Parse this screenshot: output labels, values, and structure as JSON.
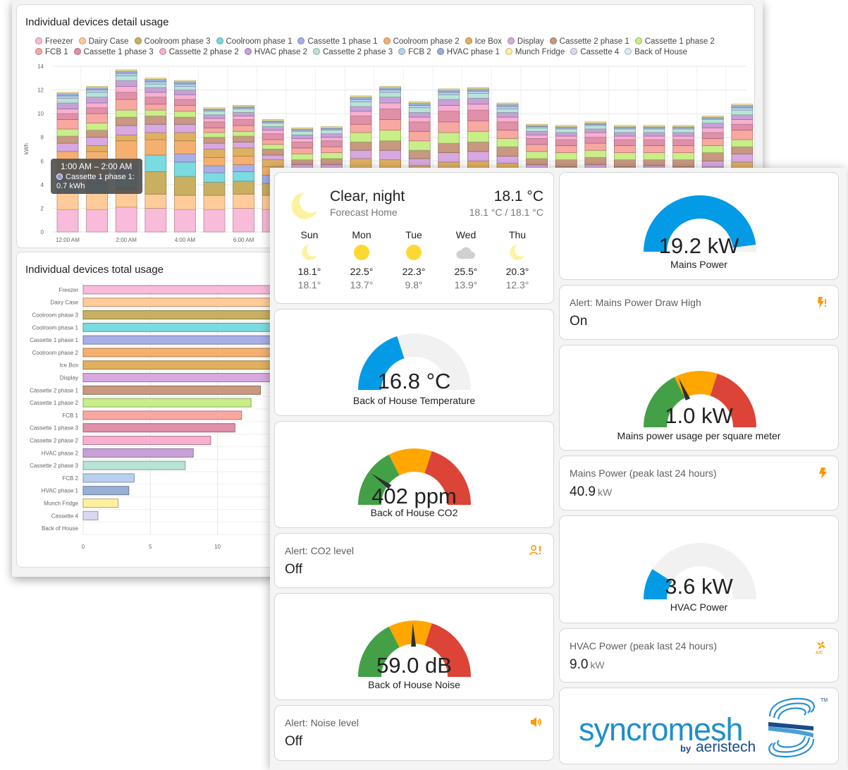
{
  "detail_card": {
    "title": "Individual devices detail usage",
    "tooltip": {
      "time": "1:00 AM – 2:00 AM",
      "series": "Cassette 1 phase 1:",
      "value": "0.7 kWh"
    }
  },
  "total_card": {
    "title": "Individual devices total usage"
  },
  "colors": {
    "Freezer": "#f8bbd9",
    "Dairy Case": "#ffcc99",
    "Coolroom phase 3": "#c8b060",
    "Coolroom phase 1": "#7adbe0",
    "Cassette 1 phase 1": "#a8aee8",
    "Coolroom phase 2": "#f5b070",
    "Ice Box": "#e0b060",
    "Display": "#d8a8e0",
    "Cassette 2 phase 1": "#c89880",
    "Cassette 1 phase 2": "#c8ee88",
    "FCB 1": "#f8a8a0",
    "Cassette 1 phase 3": "#e090a8",
    "Cassette 2 phase 2": "#f8b0d0",
    "HVAC phase 2": "#c8a0d8",
    "Cassette 2 phase 3": "#b8e4d8",
    "FCB 2": "#b8d0f0",
    "HVAC phase 1": "#98b0d8",
    "Munch Fridge": "#fff0a0",
    "Cassette 4": "#d8d8f0",
    "Back of House": "#d8ecf8"
  },
  "chart_data": [
    {
      "type": "bar",
      "title": "Individual devices detail usage",
      "stacked": true,
      "ylabel": "kWh",
      "ylim": [
        0,
        14
      ],
      "yticks": [
        "0",
        "2",
        "4",
        "6",
        "8",
        "10",
        "12",
        "14"
      ],
      "xticks": [
        "12:00 AM",
        "2:00 AM",
        "4:00 AM",
        "6:00 AM"
      ],
      "categories": [
        "0",
        "1",
        "2",
        "3",
        "4",
        "5",
        "6",
        "7",
        "8",
        "9",
        "10",
        "11",
        "12",
        "13",
        "14",
        "15",
        "16",
        "17",
        "18",
        "19",
        "20",
        "21",
        "22",
        "23"
      ],
      "series": [
        {
          "name": "Freezer",
          "values": [
            1.9,
            1.9,
            2.1,
            2.0,
            1.9,
            1.9,
            2.0,
            1.9,
            1.9,
            1.9,
            2.0,
            2.0,
            2.0,
            2.0,
            2.0,
            1.9,
            1.9,
            1.9,
            1.9,
            1.9,
            1.9,
            1.9,
            1.9,
            1.9
          ]
        },
        {
          "name": "Dairy Case",
          "values": [
            1.4,
            1.4,
            1.5,
            1.2,
            1.2,
            1.2,
            1.2,
            1.2,
            1.1,
            1.1,
            1.3,
            1.3,
            1.2,
            1.3,
            1.3,
            1.2,
            1.1,
            1.1,
            1.1,
            1.1,
            1.1,
            1.1,
            1.1,
            1.2
          ]
        },
        {
          "name": "Coolroom phase 3",
          "values": [
            0.0,
            0.0,
            0.1,
            1.9,
            1.6,
            1.1,
            1.1,
            1.0,
            0.0,
            0.0,
            0.1,
            0.0,
            0.0,
            0.0,
            0.0,
            0.0,
            0.0,
            0.0,
            0.0,
            0.0,
            0.0,
            0.0,
            0.0,
            0.0
          ]
        },
        {
          "name": "Coolroom phase 1",
          "values": [
            0.8,
            0.8,
            1.2,
            1.4,
            1.2,
            0.8,
            0.8,
            0.0,
            0.0,
            0.0,
            0.2,
            0.2,
            0.2,
            0.2,
            0.2,
            0.1,
            0.0,
            0.0,
            0.0,
            0.0,
            0.0,
            0.0,
            0.2,
            0.3
          ]
        },
        {
          "name": "Cassette 1 phase 1",
          "values": [
            0.7,
            0.7,
            0.8,
            0.0,
            0.7,
            0.6,
            0.6,
            0.7,
            0.7,
            0.7,
            0.9,
            1.0,
            0.9,
            1.0,
            1.0,
            1.2,
            0.8,
            0.7,
            0.8,
            0.7,
            0.7,
            0.7,
            0.8,
            0.9
          ]
        },
        {
          "name": "Coolroom phase 2",
          "values": [
            2.0,
            2.0,
            2.0,
            1.3,
            1.1,
            0.7,
            0.7,
            0.7,
            0.6,
            0.6,
            0.7,
            0.6,
            0.5,
            0.6,
            0.6,
            0.6,
            0.6,
            0.6,
            0.6,
            0.6,
            0.6,
            0.6,
            0.7,
            0.8
          ]
        },
        {
          "name": "Ice Box",
          "values": [
            0.0,
            0.5,
            0.5,
            0.6,
            0.7,
            0.7,
            0.7,
            0.6,
            0.9,
            0.9,
            1.0,
            1.0,
            0.8,
            0.8,
            0.9,
            0.8,
            0.8,
            0.7,
            0.8,
            0.7,
            0.8,
            0.7,
            0.8,
            0.8
          ]
        },
        {
          "name": "Display",
          "values": [
            0.7,
            0.7,
            0.8,
            0.7,
            0.7,
            0.5,
            0.5,
            0.4,
            0.5,
            0.5,
            0.7,
            0.8,
            0.6,
            0.8,
            0.8,
            0.6,
            0.5,
            0.5,
            0.5,
            0.5,
            0.5,
            0.5,
            0.5,
            0.7
          ]
        },
        {
          "name": "Cassette 2 phase 1",
          "values": [
            0.6,
            0.6,
            0.7,
            0.7,
            0.6,
            0.5,
            0.5,
            0.5,
            0.4,
            0.5,
            0.7,
            0.8,
            0.7,
            0.8,
            0.8,
            0.8,
            0.5,
            0.6,
            0.6,
            0.6,
            0.5,
            0.6,
            0.7,
            0.6
          ]
        },
        {
          "name": "Cassette 1 phase 2",
          "values": [
            0.6,
            0.6,
            0.6,
            0.5,
            0.5,
            0.4,
            0.4,
            0.4,
            0.5,
            0.5,
            0.8,
            0.9,
            0.8,
            0.9,
            0.9,
            0.7,
            0.6,
            0.6,
            0.6,
            0.6,
            0.6,
            0.6,
            0.6,
            0.6
          ]
        },
        {
          "name": "FCB 1",
          "values": [
            0.8,
            0.8,
            0.9,
            0.5,
            0.5,
            0.4,
            0.5,
            0.4,
            0.5,
            0.5,
            0.7,
            0.9,
            0.8,
            0.9,
            0.9,
            0.7,
            0.6,
            0.6,
            0.6,
            0.6,
            0.6,
            0.6,
            0.6,
            0.8
          ]
        },
        {
          "name": "Cassette 1 phase 3",
          "values": [
            0.5,
            0.5,
            0.6,
            0.6,
            0.5,
            0.5,
            0.5,
            0.5,
            0.5,
            0.5,
            0.7,
            0.9,
            0.8,
            0.9,
            0.9,
            0.7,
            0.5,
            0.5,
            0.5,
            0.5,
            0.5,
            0.5,
            0.5,
            0.5
          ]
        },
        {
          "name": "Cassette 2 phase 2",
          "values": [
            0.4,
            0.4,
            0.5,
            0.4,
            0.4,
            0.3,
            0.3,
            0.3,
            0.3,
            0.3,
            0.4,
            0.5,
            0.4,
            0.5,
            0.5,
            0.4,
            0.3,
            0.3,
            0.4,
            0.3,
            0.3,
            0.3,
            0.4,
            0.4
          ]
        },
        {
          "name": "HVAC phase 2",
          "values": [
            0.5,
            0.5,
            0.5,
            0.4,
            0.4,
            0.3,
            0.3,
            0.3,
            0.3,
            0.3,
            0.4,
            0.5,
            0.4,
            0.5,
            0.5,
            0.4,
            0.3,
            0.3,
            0.3,
            0.3,
            0.3,
            0.3,
            0.4,
            0.4
          ]
        },
        {
          "name": "Cassette 2 phase 3",
          "values": [
            0.4,
            0.4,
            0.4,
            0.3,
            0.3,
            0.3,
            0.3,
            0.3,
            0.3,
            0.3,
            0.4,
            0.4,
            0.4,
            0.4,
            0.4,
            0.3,
            0.3,
            0.3,
            0.3,
            0.3,
            0.3,
            0.3,
            0.3,
            0.4
          ]
        },
        {
          "name": "FCB 2",
          "values": [
            0.2,
            0.2,
            0.2,
            0.2,
            0.2,
            0.1,
            0.1,
            0.1,
            0.1,
            0.1,
            0.2,
            0.2,
            0.2,
            0.2,
            0.2,
            0.2,
            0.1,
            0.1,
            0.1,
            0.1,
            0.1,
            0.1,
            0.1,
            0.2
          ]
        },
        {
          "name": "HVAC phase 1",
          "values": [
            0.2,
            0.2,
            0.2,
            0.2,
            0.2,
            0.1,
            0.1,
            0.1,
            0.1,
            0.1,
            0.2,
            0.2,
            0.2,
            0.2,
            0.2,
            0.2,
            0.1,
            0.1,
            0.1,
            0.1,
            0.1,
            0.1,
            0.1,
            0.2
          ]
        },
        {
          "name": "Munch Fridge",
          "values": [
            0.1,
            0.1,
            0.1,
            0.1,
            0.1,
            0.1,
            0.1,
            0.1,
            0.1,
            0.1,
            0.1,
            0.1,
            0.1,
            0.1,
            0.1,
            0.1,
            0.1,
            0.1,
            0.1,
            0.1,
            0.1,
            0.1,
            0.1,
            0.1
          ]
        },
        {
          "name": "Cassette 4",
          "values": [
            0.0,
            0.0,
            0.0,
            0.0,
            0.0,
            0.0,
            0.0,
            0.0,
            0.0,
            0.0,
            0.0,
            0.0,
            0.0,
            0.0,
            0.0,
            0.0,
            0.0,
            0.0,
            0.0,
            0.0,
            0.0,
            0.0,
            0.0,
            0.0
          ]
        },
        {
          "name": "Back of House",
          "values": [
            0.0,
            0.0,
            0.0,
            0.0,
            0.0,
            0.0,
            0.0,
            0.0,
            0.0,
            0.0,
            0.0,
            0.0,
            0.0,
            0.0,
            0.0,
            0.0,
            0.0,
            0.0,
            0.0,
            0.0,
            0.0,
            0.0,
            0.0,
            0.0
          ]
        }
      ]
    },
    {
      "type": "bar",
      "orientation": "horizontal",
      "title": "Individual devices total usage",
      "xticks": [
        "0",
        "5",
        "10"
      ],
      "categories": [
        "Freezer",
        "Dairy Case",
        "Coolroom phase 3",
        "Coolroom phase 1",
        "Cassette 1 phase 1",
        "Coolroom phase 2",
        "Ice Box",
        "Display",
        "Cassette 2 phase 1",
        "Cassette 1 phase 2",
        "FCB 1",
        "Cassette 1 phase 3",
        "Cassette 2 phase 2",
        "HVAC phase 2",
        "Cassette 2 phase 3",
        "FCB 2",
        "HVAC phase 1",
        "Munch Fridge",
        "Cassette 4",
        "Back of House"
      ],
      "values": [
        48,
        30,
        20,
        19,
        19,
        18,
        17,
        15,
        13.2,
        12.5,
        11.8,
        11.3,
        9.5,
        8.2,
        7.6,
        3.8,
        3.4,
        2.6,
        1.1,
        0
      ]
    }
  ],
  "weather": {
    "condition": "Clear, night",
    "location": "Forecast Home",
    "temp": "18.1 °C",
    "range": "18.1 °C / 18.1 °C",
    "forecast": [
      {
        "day": "Sun",
        "icon": "moon-icon",
        "hi": "18.1°",
        "lo": "18.1°"
      },
      {
        "day": "Mon",
        "icon": "sun-icon",
        "hi": "22.5°",
        "lo": "13.7°"
      },
      {
        "day": "Tue",
        "icon": "sun-icon",
        "hi": "22.3°",
        "lo": "9.8°"
      },
      {
        "day": "Wed",
        "icon": "cloud-icon",
        "hi": "25.5°",
        "lo": "13.9°"
      },
      {
        "day": "Thu",
        "icon": "moon-icon",
        "hi": "20.3°",
        "lo": "12.3°"
      }
    ]
  },
  "gauges": {
    "mains_power": {
      "value": "19.2 kW",
      "name": "Mains Power",
      "fraction": 0.96
    },
    "temperature": {
      "value": "16.8 °C",
      "name": "Back of House Temperature",
      "fraction": 0.4
    },
    "co2": {
      "value": "402 ppm",
      "name": "Back of House CO2",
      "fraction": 0.2
    },
    "per_sqm": {
      "value": "1.0 kW",
      "name": "Mains power usage per square meter",
      "fraction": 0.37
    },
    "hvac": {
      "value": "3.6 kW",
      "name": "HVAC Power",
      "fraction": 0.18
    },
    "noise": {
      "value": "59.0 dB",
      "name": "Back of House Noise",
      "fraction": 0.49
    }
  },
  "entities": {
    "alert_mains": {
      "name": "Alert: Mains Power Draw High",
      "state": "On",
      "icon": "flash-alert-icon"
    },
    "alert_co2": {
      "name": "Alert: CO2 level",
      "state": "Off",
      "icon": "account-alert-icon"
    },
    "alert_noise": {
      "name": "Alert: Noise level",
      "state": "Off",
      "icon": "volume-icon"
    },
    "mains_peak": {
      "name": "Mains Power (peak last 24 hours)",
      "state": "40.9",
      "unit": "kW",
      "icon": "flash-icon"
    },
    "hvac_peak": {
      "name": "HVAC Power (peak last 24 hours)",
      "state": "9.0",
      "unit": "kW",
      "icon": "air-conditioner-icon"
    }
  },
  "logo": {
    "word": "syncromesh",
    "by": "by",
    "company": "aeristech",
    "tm": "TM"
  }
}
